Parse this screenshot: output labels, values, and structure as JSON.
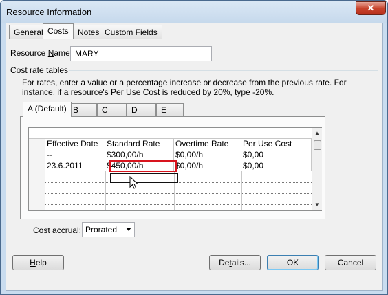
{
  "window": {
    "title": "Resource Information",
    "close_glyph": "✕"
  },
  "tabs": [
    {
      "label": "General"
    },
    {
      "label": "Costs"
    },
    {
      "label": "Notes"
    },
    {
      "label": "Custom Fields"
    }
  ],
  "resource_name": {
    "label_pre": "Resource ",
    "label_u": "N",
    "label_post": "ame:",
    "value": "MARY"
  },
  "cost_rate_tables": {
    "label": "Cost rate tables",
    "instructions_line1": "For rates, enter a value or a percentage increase or decrease from the previous rate. For",
    "instructions_line2": "instance, if a resource's Per Use Cost is reduced by 20%, type -20%.",
    "subtabs": [
      {
        "label": "A (Default)"
      },
      {
        "label": "B"
      },
      {
        "label": "C"
      },
      {
        "label": "D"
      },
      {
        "label": "E"
      }
    ],
    "columns": [
      "Effective Date",
      "Standard Rate",
      "Overtime Rate",
      "Per Use Cost"
    ],
    "rows": [
      [
        "--",
        "$300,00/h",
        "$0,00/h",
        "$0,00"
      ],
      [
        "23.6.2011",
        "$450,00/h",
        "$0,00/h",
        "$0,00"
      ]
    ]
  },
  "cost_accrual": {
    "label_pre": "Cost ",
    "label_u": "a",
    "label_post": "ccrual:",
    "value": "Prorated"
  },
  "buttons": {
    "help_u": "H",
    "help_rest": "elp",
    "details_pre": "De",
    "details_u": "t",
    "details_post": "ails...",
    "ok": "OK",
    "cancel": "Cancel"
  },
  "colors": {
    "highlight_border": "#d8141e",
    "default_button_accent": "#3c7fb1"
  }
}
